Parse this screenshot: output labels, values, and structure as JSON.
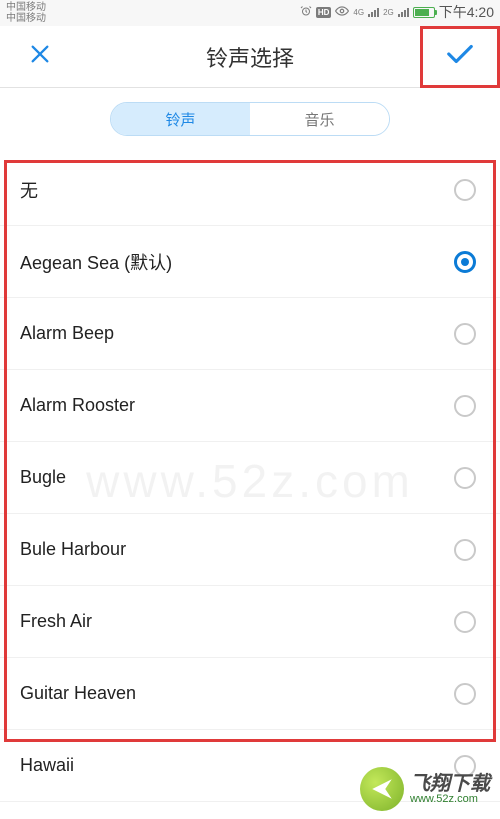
{
  "status": {
    "carrier1": "中国移动",
    "carrier2": "中国移动",
    "alarm_icon": "alarm",
    "hd_label": "HD",
    "net1": "4G",
    "net2": "2G",
    "time": "下午4:20"
  },
  "header": {
    "title": "铃声选择"
  },
  "tabs": {
    "ringtone": "铃声",
    "music": "音乐",
    "active": "ringtone"
  },
  "ringtones": [
    {
      "label": "无",
      "selected": false
    },
    {
      "label": "Aegean Sea (默认)",
      "selected": true
    },
    {
      "label": "Alarm Beep",
      "selected": false
    },
    {
      "label": "Alarm Rooster",
      "selected": false
    },
    {
      "label": "Bugle",
      "selected": false
    },
    {
      "label": "Bule Harbour",
      "selected": false
    },
    {
      "label": "Fresh Air",
      "selected": false
    },
    {
      "label": "Guitar Heaven",
      "selected": false
    },
    {
      "label": "Hawaii",
      "selected": false
    }
  ],
  "watermark": "www.52z.com",
  "footer": {
    "brand": "飞翔下载",
    "url": "www.52z.com"
  }
}
